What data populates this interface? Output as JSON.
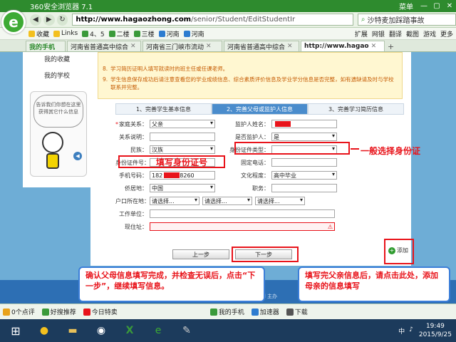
{
  "browser": {
    "title": "360安全浏览器 7.1",
    "menu_label": "菜单",
    "min": "—",
    "max": "▢",
    "close": "✕",
    "logo_letter": "e",
    "url_host": "http://www.hagaozhong.com",
    "url_path": "/senior/Student/EditStudentIr",
    "search_text": "沙特麦加踩踏事故"
  },
  "bookmarks": {
    "items": [
      {
        "label": "收藏",
        "color": "#f3c01e"
      },
      {
        "label": "Links",
        "color": "#f3c01e"
      },
      {
        "label": "4、5",
        "color": "#3a9a3a"
      },
      {
        "label": "二楼",
        "color": "#3a9a3a"
      },
      {
        "label": "三楼",
        "color": "#3a9a3a"
      },
      {
        "label": "河南",
        "color": "#2d7cd0"
      },
      {
        "label": "河南",
        "color": "#2d7cd0"
      }
    ],
    "right": [
      "扩展",
      "网银",
      "翻译",
      "截图",
      "游戏",
      "更多"
    ]
  },
  "tabs": [
    {
      "label": "我的手机",
      "kind": "first"
    },
    {
      "label": "河南省普通高中综合",
      "kind": "normal"
    },
    {
      "label": "河南省三门峡市流动",
      "kind": "normal"
    },
    {
      "label": "河南省普通高中综合",
      "kind": "normal"
    },
    {
      "label": "http://www.hagao",
      "kind": "active"
    }
  ],
  "sidebar": {
    "links": [
      "我的收藏",
      "我的学校"
    ],
    "bubble": "告诉我们你想在这里获得其它什么信息"
  },
  "notes": [
    {
      "num": "8.",
      "text": "学习简历证明人填写就读时的班主任或任课老师。"
    },
    {
      "num": "9.",
      "text": "学生信息保存成功后请注意查看您的学业成绩信息、综合素质评价信息及学业学分信息是否完整，如有遗缺请及时与学校联系并完整。"
    }
  ],
  "steps": [
    "1、完善学生基本信息",
    "2、完善父母或监护人信息",
    "3、完善学习简历信息"
  ],
  "form": {
    "relation_label": "家庭关系：",
    "relation_value": "父亲",
    "guardian_name_label": "监护人姓名：",
    "relation_desc_label": "关系说明：",
    "is_guardian_label": "是否监护人：",
    "is_guardian_value": "是",
    "ethnic_label": "民族：",
    "ethnic_value": "汉族",
    "id_type_label": "身份证件类型：",
    "id_no_label": "身份证件号：",
    "fixed_phone_label": "固定电话：",
    "mobile_label": "手机号码：",
    "mobile_value_a": "182",
    "mobile_value_b": "8260",
    "education_label": "文化程度：",
    "education_value": "高中毕业",
    "residence_label": "侨居地：",
    "residence_value": "中国",
    "job_label": "职务：",
    "hukou_label": "户口所在地：",
    "select_placeholder": "请选择...",
    "workplace_label": "工作单位：",
    "address_label": "现住址：",
    "prev_button": "上一步",
    "next_button": "下一步",
    "add_button": "添加"
  },
  "annotations": {
    "id_type_hint": "一般选择身份证",
    "id_no_hint": "填写身份证号",
    "confirm_callout": "确认父母信息填写完成，并检查无误后，点击“下一步”，继续填写信息。",
    "add_callout": "填写完父亲信息后，请点击此处，添加母亲的信息填写"
  },
  "footer_text": "All Rights Reserved 主办",
  "status": {
    "items": [
      "0个点评",
      "好搜推荐",
      "今日特卖"
    ],
    "right": [
      "我的手机",
      "加速器",
      "下载"
    ]
  },
  "taskbar": {
    "time": "19:49",
    "date": "2015/9/25",
    "lang": "中"
  }
}
